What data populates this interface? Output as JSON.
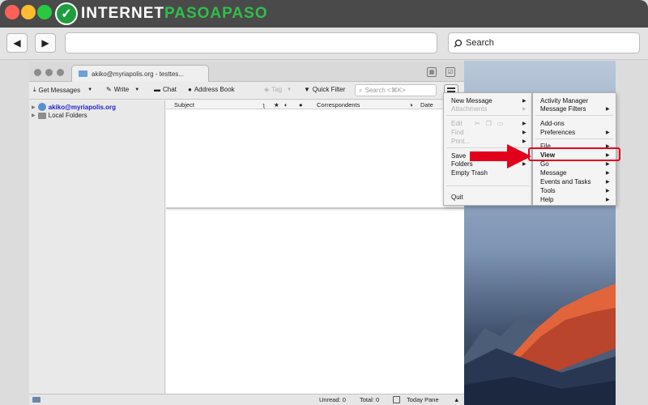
{
  "site": {
    "logo_letter": "✓",
    "logo_part1": "INTERNET",
    "logo_part2": "PASOAPASO",
    "search_placeholder": "Search"
  },
  "colors": {
    "accent_green": "#2fbf4a",
    "highlight_red": "#e3001b"
  },
  "thunderbird": {
    "tab_title": "akiko@myriapolis.org - testtes...",
    "toolbar": {
      "get_messages": "Get Messages",
      "write": "Write",
      "chat": "Chat",
      "address_book": "Address Book",
      "tag": "Tag",
      "quick_filter": "Quick Filter",
      "search_placeholder": "Search <⌘K>"
    },
    "folders": [
      {
        "label": "akiko@myriapolis.org"
      },
      {
        "label": "Local Folders"
      }
    ],
    "columns": {
      "subject": "Subject",
      "correspondents": "Correspondents",
      "date": "Date"
    },
    "status": {
      "unread": "Unread: 0",
      "total": "Total: 0",
      "today_pane": "Today Pane"
    }
  },
  "main_menu": {
    "new_message": "New Message",
    "attachments": "Attachments",
    "edit": "Edit",
    "find": "Find",
    "print": "Print...",
    "save_as": "Save",
    "folders": "Folders",
    "empty_trash": "Empty Trash",
    "quit": "Quit"
  },
  "sub_menu": {
    "activity_manager": "Activity Manager",
    "message_filters": "Message Filters",
    "add_ons": "Add-ons",
    "preferences": "Preferences",
    "file": "File",
    "view": "View",
    "go": "Go",
    "message": "Message",
    "events_and_tasks": "Events and Tasks",
    "tools": "Tools",
    "help": "Help"
  }
}
